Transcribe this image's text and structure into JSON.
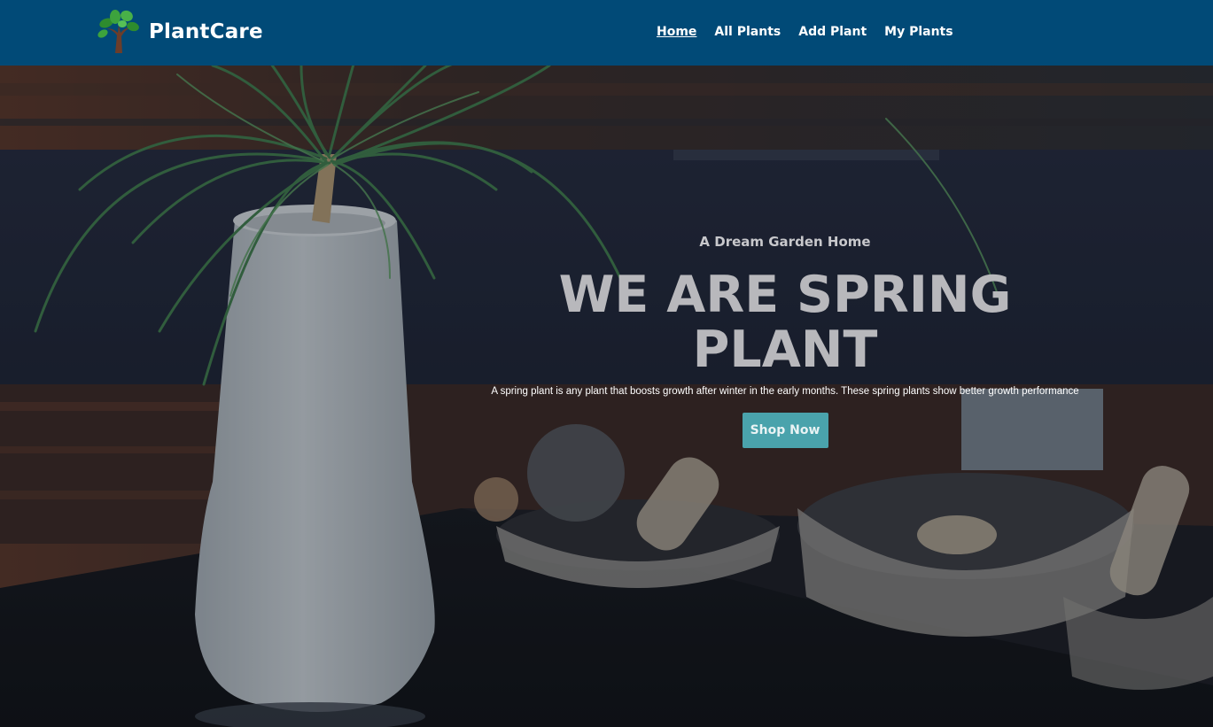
{
  "brand": {
    "name": "PlantCare",
    "logo_icon": "tree-logo-icon"
  },
  "nav": {
    "items": [
      {
        "label": "Home",
        "active": true
      },
      {
        "label": "All Plants",
        "active": false
      },
      {
        "label": "Add Plant",
        "active": false
      },
      {
        "label": "My Plants",
        "active": false
      }
    ]
  },
  "hero": {
    "kicker": "A Dream Garden Home",
    "title": "WE ARE SPRING PLANT",
    "description": "A spring plant is any plant that boosts growth after winter in the early months. These spring plants show better growth performance",
    "cta_label": "Shop Now"
  },
  "colors": {
    "header_bg": "#014a77",
    "button_bg": "#4aa3ac"
  }
}
